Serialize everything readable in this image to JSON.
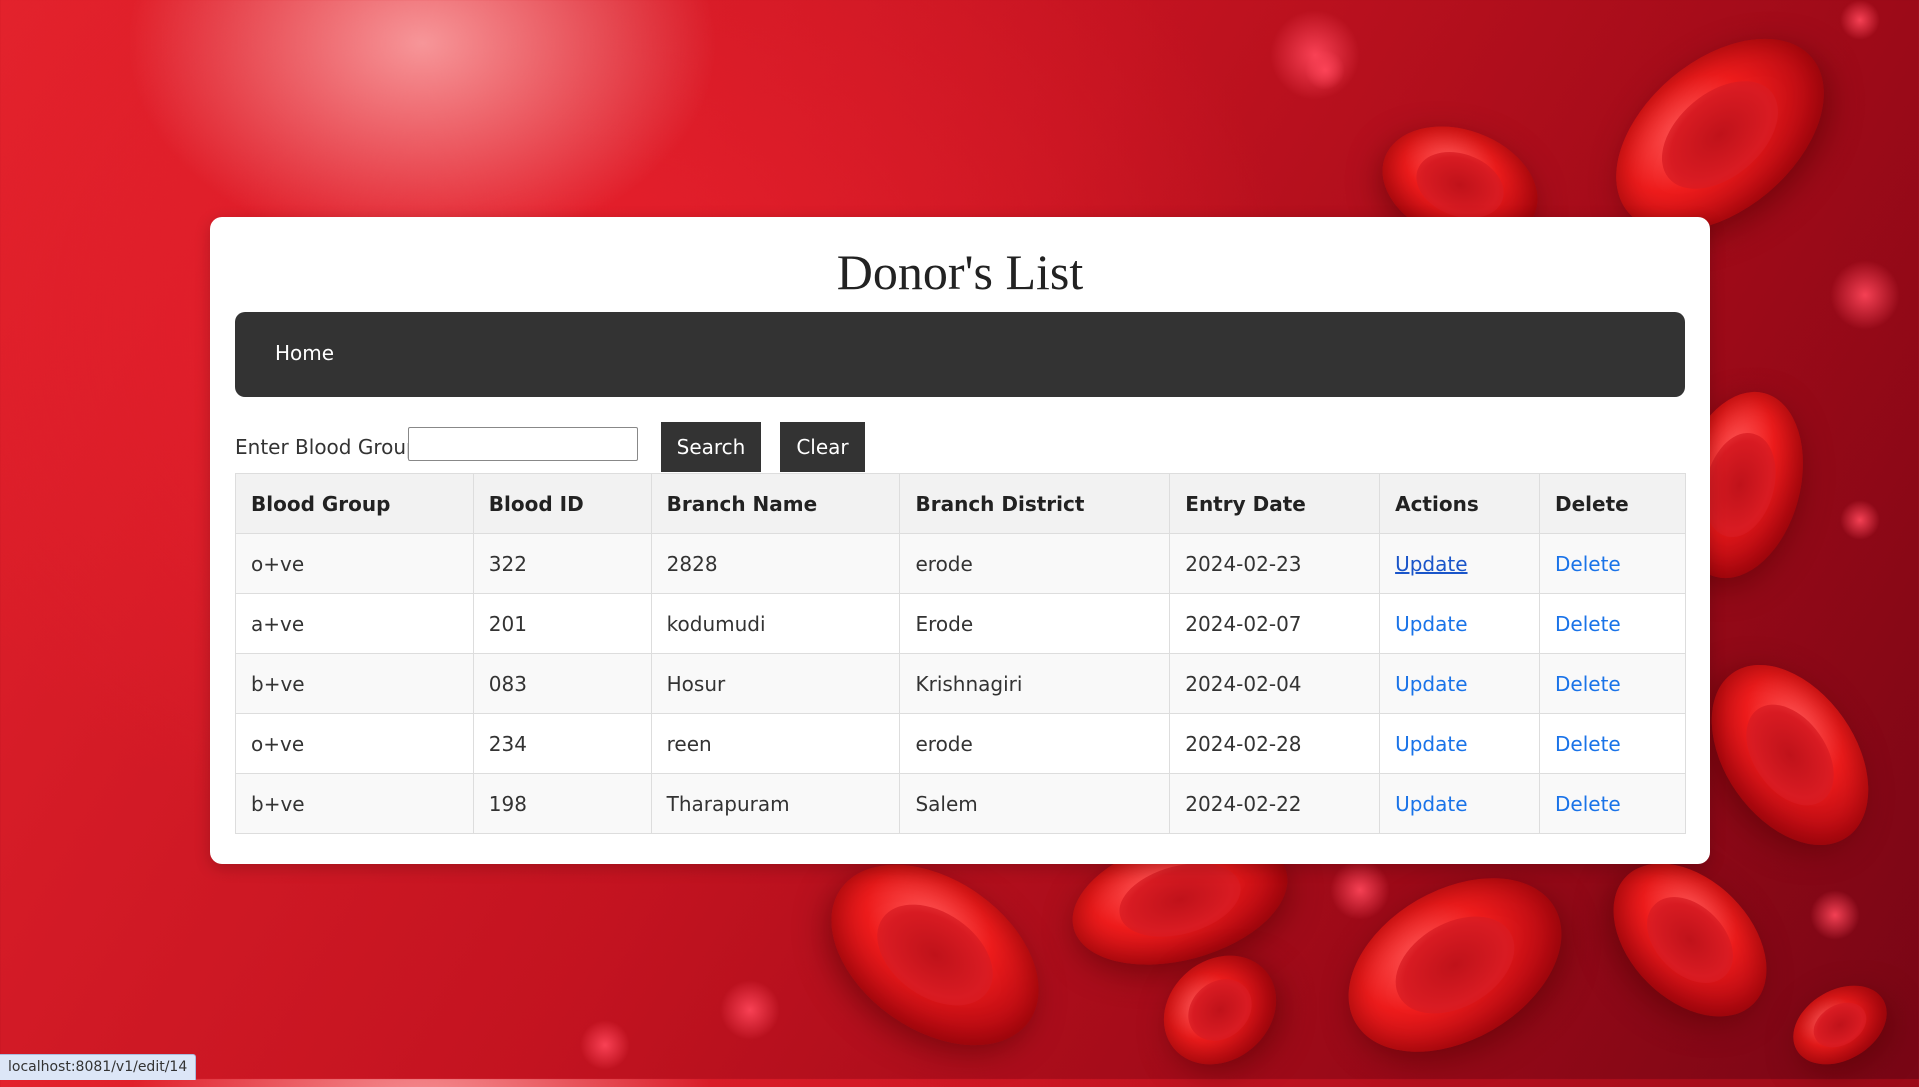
{
  "page": {
    "title": "Donor's List"
  },
  "navbar": {
    "home_label": "Home"
  },
  "search": {
    "label": "Enter Blood Group:",
    "value": "",
    "search_button": "Search",
    "clear_button": "Clear"
  },
  "table": {
    "headers": [
      "Blood Group",
      "Blood ID",
      "Branch Name",
      "Branch District",
      "Entry Date",
      "Actions",
      "Delete"
    ],
    "rows": [
      {
        "blood_group": "o+ve",
        "blood_id": "322",
        "branch_name": "2828",
        "branch_district": "erode",
        "entry_date": "2024-02-23",
        "action": "Update",
        "delete": "Delete"
      },
      {
        "blood_group": "a+ve",
        "blood_id": "201",
        "branch_name": "kodumudi",
        "branch_district": "Erode",
        "entry_date": "2024-02-07",
        "action": "Update",
        "delete": "Delete"
      },
      {
        "blood_group": "b+ve",
        "blood_id": "083",
        "branch_name": "Hosur",
        "branch_district": "Krishnagiri",
        "entry_date": "2024-02-04",
        "action": "Update",
        "delete": "Delete"
      },
      {
        "blood_group": "o+ve",
        "blood_id": "234",
        "branch_name": "reen",
        "branch_district": "erode",
        "entry_date": "2024-02-28",
        "action": "Update",
        "delete": "Delete"
      },
      {
        "blood_group": "b+ve",
        "blood_id": "198",
        "branch_name": "Tharapuram",
        "branch_district": "Salem",
        "entry_date": "2024-02-22",
        "action": "Update",
        "delete": "Delete"
      }
    ]
  },
  "status_bar": {
    "url": "localhost:8081/v1/edit/14"
  },
  "colors": {
    "navbar": "#333333",
    "link": "#1a73e8",
    "background_red": "#c31320"
  }
}
